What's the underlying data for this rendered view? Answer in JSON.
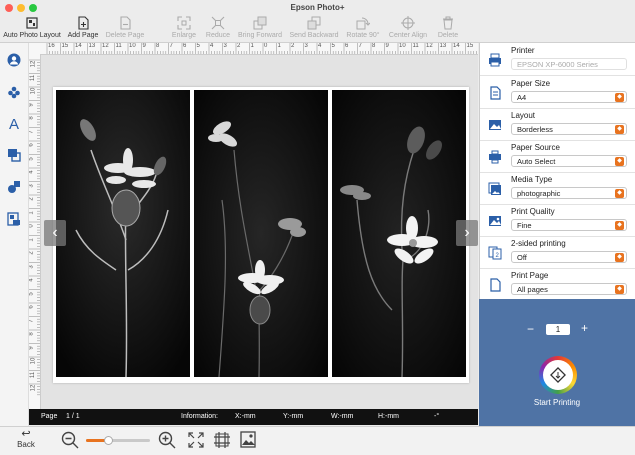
{
  "window": {
    "title": "Epson Photo+"
  },
  "toolbar": [
    {
      "key": "auto_photo_layout",
      "label": "Auto Photo Layout",
      "icon": "auto-layout-icon",
      "enabled": true
    },
    {
      "key": "add_page",
      "label": "Add Page",
      "icon": "add-page-icon",
      "enabled": true
    },
    {
      "key": "delete_page",
      "label": "Delete Page",
      "icon": "delete-page-icon",
      "enabled": false
    },
    {
      "key": "enlarge",
      "label": "Enlarge",
      "icon": "enlarge-icon",
      "enabled": false
    },
    {
      "key": "reduce",
      "label": "Reduce",
      "icon": "reduce-icon",
      "enabled": false
    },
    {
      "key": "bring_forward",
      "label": "Bring Forward",
      "icon": "bring-forward-icon",
      "enabled": false
    },
    {
      "key": "send_backward",
      "label": "Send Backward",
      "icon": "send-backward-icon",
      "enabled": false
    },
    {
      "key": "rotate_90",
      "label": "Rotate 90°",
      "icon": "rotate-icon",
      "enabled": false
    },
    {
      "key": "center_align",
      "label": "Center Align",
      "icon": "center-align-icon",
      "enabled": false
    },
    {
      "key": "delete",
      "label": "Delete",
      "icon": "delete-icon",
      "enabled": false
    }
  ],
  "left_tools": [
    "person-icon",
    "stamp-icon",
    "text-icon",
    "frame-icon",
    "shapes-icon",
    "template-icon"
  ],
  "ruler": {
    "top": [
      "16",
      "15",
      "14",
      "13",
      "12",
      "11",
      "10",
      "9",
      "8",
      "7",
      "6",
      "5",
      "4",
      "3",
      "2",
      "1",
      "0",
      "1",
      "2",
      "3",
      "4",
      "5",
      "6",
      "7",
      "8",
      "9",
      "10",
      "11",
      "12",
      "13",
      "14",
      "15",
      "16"
    ],
    "left": [
      "12",
      "11",
      "10",
      "9",
      "8",
      "7",
      "6",
      "5",
      "4",
      "3",
      "2",
      "1",
      "0",
      "1",
      "2",
      "3",
      "4",
      "5",
      "6",
      "7",
      "8",
      "9",
      "10",
      "11",
      "12"
    ]
  },
  "status": {
    "page_label": "Page",
    "page_value": "1 / 1",
    "information_label": "Information:",
    "x": "X:-mm",
    "y": "Y:-mm",
    "w": "W:-mm",
    "h": "H:-mm",
    "angle": "-°"
  },
  "bottom": {
    "back_label": "Back",
    "zoom_level": 0.35
  },
  "settings": [
    {
      "key": "printer",
      "label": "Printer",
      "value": "EPSON XP-6000 Series",
      "icon": "printer-icon",
      "disabled": true
    },
    {
      "key": "paper_size",
      "label": "Paper Size",
      "value": "A4",
      "icon": "paper-size-icon",
      "disabled": false
    },
    {
      "key": "layout",
      "label": "Layout",
      "value": "Borderless",
      "icon": "layout-icon",
      "disabled": false
    },
    {
      "key": "paper_source",
      "label": "Paper Source",
      "value": "Auto Select",
      "icon": "paper-source-icon",
      "disabled": false
    },
    {
      "key": "media_type",
      "label": "Media Type",
      "value": "photographic",
      "icon": "media-type-icon",
      "disabled": false
    },
    {
      "key": "print_quality",
      "label": "Print Quality",
      "value": "Fine",
      "icon": "print-quality-icon",
      "disabled": false
    },
    {
      "key": "two_sided",
      "label": "2-sided printing",
      "value": "Off",
      "icon": "two-sided-icon",
      "disabled": false
    },
    {
      "key": "print_page",
      "label": "Print Page",
      "value": "All pages",
      "icon": "print-page-icon",
      "disabled": false
    }
  ],
  "print": {
    "copies": "1",
    "minus": "−",
    "plus": "+",
    "start_label": "Start Printing"
  },
  "colors": {
    "accent": "#2b5fa8",
    "panel_blue": "#4f73a5",
    "dropdown": "#e8731f"
  }
}
